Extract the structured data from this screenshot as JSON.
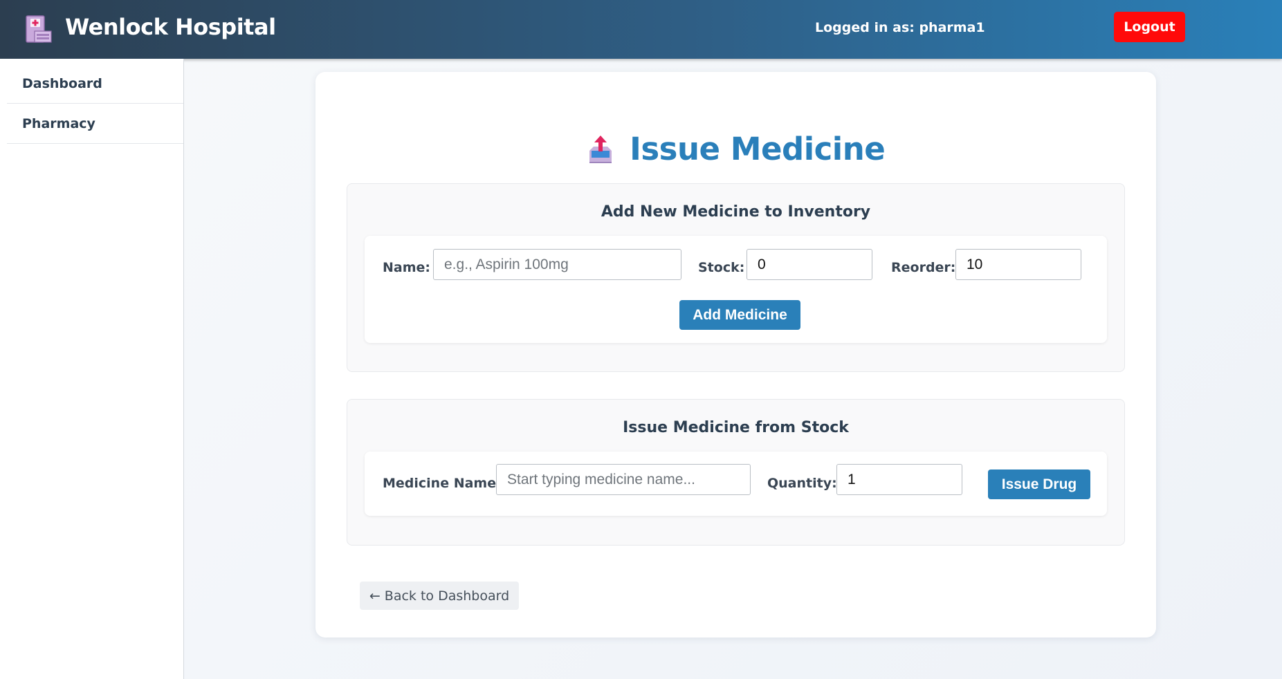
{
  "header": {
    "app_title": "Wenlock Hospital",
    "user_text": "Logged in as: pharma1",
    "logout_label": "Logout"
  },
  "sidebar": {
    "items": [
      {
        "label": "Dashboard"
      },
      {
        "label": "Pharmacy"
      }
    ]
  },
  "main": {
    "page_title": "Issue Medicine",
    "add_section": {
      "title": "Add New Medicine to Inventory",
      "name_label": "Name:",
      "name_placeholder": "e.g., Aspirin 100mg",
      "name_value": "",
      "stock_label": "Stock:",
      "stock_value": "0",
      "reorder_label": "Reorder:",
      "reorder_value": "10",
      "submit_label": "Add Medicine"
    },
    "issue_section": {
      "title": "Issue Medicine from Stock",
      "medicine_label": "Medicine Name:",
      "medicine_placeholder": "Start typing medicine name...",
      "medicine_value": "",
      "quantity_label": "Quantity:",
      "quantity_value": "1",
      "submit_label": "Issue Drug"
    },
    "back_label": "← Back to Dashboard"
  },
  "colors": {
    "accent": "#2a80b9",
    "logout": "#ff0a0a",
    "header_start": "#2c3e50",
    "header_end": "#2a80b9"
  },
  "icons": {
    "brand": "hospital-icon",
    "title": "outbox-tray-icon"
  }
}
